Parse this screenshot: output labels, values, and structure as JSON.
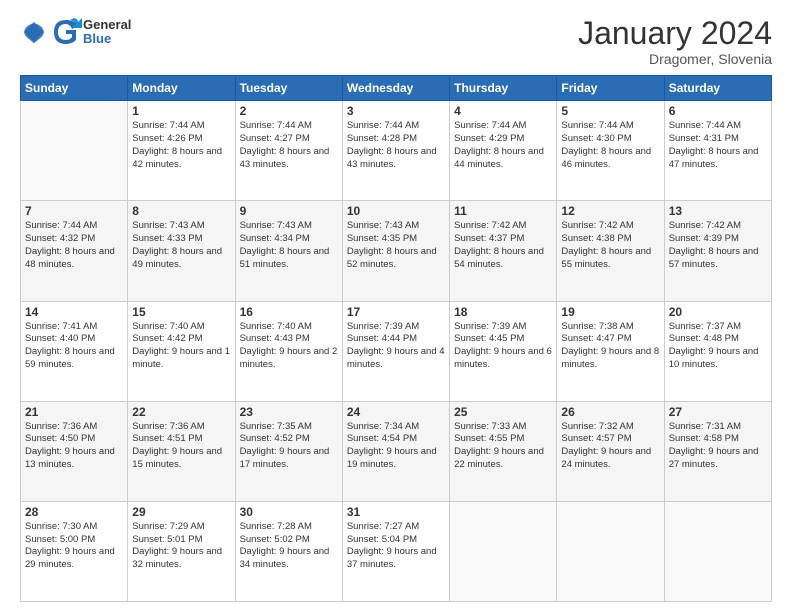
{
  "logo": {
    "line1": "General",
    "line2": "Blue"
  },
  "title": "January 2024",
  "subtitle": "Dragomer, Slovenia",
  "weekdays": [
    "Sunday",
    "Monday",
    "Tuesday",
    "Wednesday",
    "Thursday",
    "Friday",
    "Saturday"
  ],
  "weeks": [
    [
      {
        "day": "",
        "sunrise": "",
        "sunset": "",
        "daylight": "",
        "empty": true
      },
      {
        "day": "1",
        "sunrise": "Sunrise: 7:44 AM",
        "sunset": "Sunset: 4:26 PM",
        "daylight": "Daylight: 8 hours and 42 minutes."
      },
      {
        "day": "2",
        "sunrise": "Sunrise: 7:44 AM",
        "sunset": "Sunset: 4:27 PM",
        "daylight": "Daylight: 8 hours and 43 minutes."
      },
      {
        "day": "3",
        "sunrise": "Sunrise: 7:44 AM",
        "sunset": "Sunset: 4:28 PM",
        "daylight": "Daylight: 8 hours and 43 minutes."
      },
      {
        "day": "4",
        "sunrise": "Sunrise: 7:44 AM",
        "sunset": "Sunset: 4:29 PM",
        "daylight": "Daylight: 8 hours and 44 minutes."
      },
      {
        "day": "5",
        "sunrise": "Sunrise: 7:44 AM",
        "sunset": "Sunset: 4:30 PM",
        "daylight": "Daylight: 8 hours and 46 minutes."
      },
      {
        "day": "6",
        "sunrise": "Sunrise: 7:44 AM",
        "sunset": "Sunset: 4:31 PM",
        "daylight": "Daylight: 8 hours and 47 minutes."
      }
    ],
    [
      {
        "day": "7",
        "sunrise": "Sunrise: 7:44 AM",
        "sunset": "Sunset: 4:32 PM",
        "daylight": "Daylight: 8 hours and 48 minutes."
      },
      {
        "day": "8",
        "sunrise": "Sunrise: 7:43 AM",
        "sunset": "Sunset: 4:33 PM",
        "daylight": "Daylight: 8 hours and 49 minutes."
      },
      {
        "day": "9",
        "sunrise": "Sunrise: 7:43 AM",
        "sunset": "Sunset: 4:34 PM",
        "daylight": "Daylight: 8 hours and 51 minutes."
      },
      {
        "day": "10",
        "sunrise": "Sunrise: 7:43 AM",
        "sunset": "Sunset: 4:35 PM",
        "daylight": "Daylight: 8 hours and 52 minutes."
      },
      {
        "day": "11",
        "sunrise": "Sunrise: 7:42 AM",
        "sunset": "Sunset: 4:37 PM",
        "daylight": "Daylight: 8 hours and 54 minutes."
      },
      {
        "day": "12",
        "sunrise": "Sunrise: 7:42 AM",
        "sunset": "Sunset: 4:38 PM",
        "daylight": "Daylight: 8 hours and 55 minutes."
      },
      {
        "day": "13",
        "sunrise": "Sunrise: 7:42 AM",
        "sunset": "Sunset: 4:39 PM",
        "daylight": "Daylight: 8 hours and 57 minutes."
      }
    ],
    [
      {
        "day": "14",
        "sunrise": "Sunrise: 7:41 AM",
        "sunset": "Sunset: 4:40 PM",
        "daylight": "Daylight: 8 hours and 59 minutes."
      },
      {
        "day": "15",
        "sunrise": "Sunrise: 7:40 AM",
        "sunset": "Sunset: 4:42 PM",
        "daylight": "Daylight: 9 hours and 1 minute."
      },
      {
        "day": "16",
        "sunrise": "Sunrise: 7:40 AM",
        "sunset": "Sunset: 4:43 PM",
        "daylight": "Daylight: 9 hours and 2 minutes."
      },
      {
        "day": "17",
        "sunrise": "Sunrise: 7:39 AM",
        "sunset": "Sunset: 4:44 PM",
        "daylight": "Daylight: 9 hours and 4 minutes."
      },
      {
        "day": "18",
        "sunrise": "Sunrise: 7:39 AM",
        "sunset": "Sunset: 4:45 PM",
        "daylight": "Daylight: 9 hours and 6 minutes."
      },
      {
        "day": "19",
        "sunrise": "Sunrise: 7:38 AM",
        "sunset": "Sunset: 4:47 PM",
        "daylight": "Daylight: 9 hours and 8 minutes."
      },
      {
        "day": "20",
        "sunrise": "Sunrise: 7:37 AM",
        "sunset": "Sunset: 4:48 PM",
        "daylight": "Daylight: 9 hours and 10 minutes."
      }
    ],
    [
      {
        "day": "21",
        "sunrise": "Sunrise: 7:36 AM",
        "sunset": "Sunset: 4:50 PM",
        "daylight": "Daylight: 9 hours and 13 minutes."
      },
      {
        "day": "22",
        "sunrise": "Sunrise: 7:36 AM",
        "sunset": "Sunset: 4:51 PM",
        "daylight": "Daylight: 9 hours and 15 minutes."
      },
      {
        "day": "23",
        "sunrise": "Sunrise: 7:35 AM",
        "sunset": "Sunset: 4:52 PM",
        "daylight": "Daylight: 9 hours and 17 minutes."
      },
      {
        "day": "24",
        "sunrise": "Sunrise: 7:34 AM",
        "sunset": "Sunset: 4:54 PM",
        "daylight": "Daylight: 9 hours and 19 minutes."
      },
      {
        "day": "25",
        "sunrise": "Sunrise: 7:33 AM",
        "sunset": "Sunset: 4:55 PM",
        "daylight": "Daylight: 9 hours and 22 minutes."
      },
      {
        "day": "26",
        "sunrise": "Sunrise: 7:32 AM",
        "sunset": "Sunset: 4:57 PM",
        "daylight": "Daylight: 9 hours and 24 minutes."
      },
      {
        "day": "27",
        "sunrise": "Sunrise: 7:31 AM",
        "sunset": "Sunset: 4:58 PM",
        "daylight": "Daylight: 9 hours and 27 minutes."
      }
    ],
    [
      {
        "day": "28",
        "sunrise": "Sunrise: 7:30 AM",
        "sunset": "Sunset: 5:00 PM",
        "daylight": "Daylight: 9 hours and 29 minutes."
      },
      {
        "day": "29",
        "sunrise": "Sunrise: 7:29 AM",
        "sunset": "Sunset: 5:01 PM",
        "daylight": "Daylight: 9 hours and 32 minutes."
      },
      {
        "day": "30",
        "sunrise": "Sunrise: 7:28 AM",
        "sunset": "Sunset: 5:02 PM",
        "daylight": "Daylight: 9 hours and 34 minutes."
      },
      {
        "day": "31",
        "sunrise": "Sunrise: 7:27 AM",
        "sunset": "Sunset: 5:04 PM",
        "daylight": "Daylight: 9 hours and 37 minutes."
      },
      {
        "day": "",
        "sunrise": "",
        "sunset": "",
        "daylight": "",
        "empty": true
      },
      {
        "day": "",
        "sunrise": "",
        "sunset": "",
        "daylight": "",
        "empty": true
      },
      {
        "day": "",
        "sunrise": "",
        "sunset": "",
        "daylight": "",
        "empty": true
      }
    ]
  ]
}
